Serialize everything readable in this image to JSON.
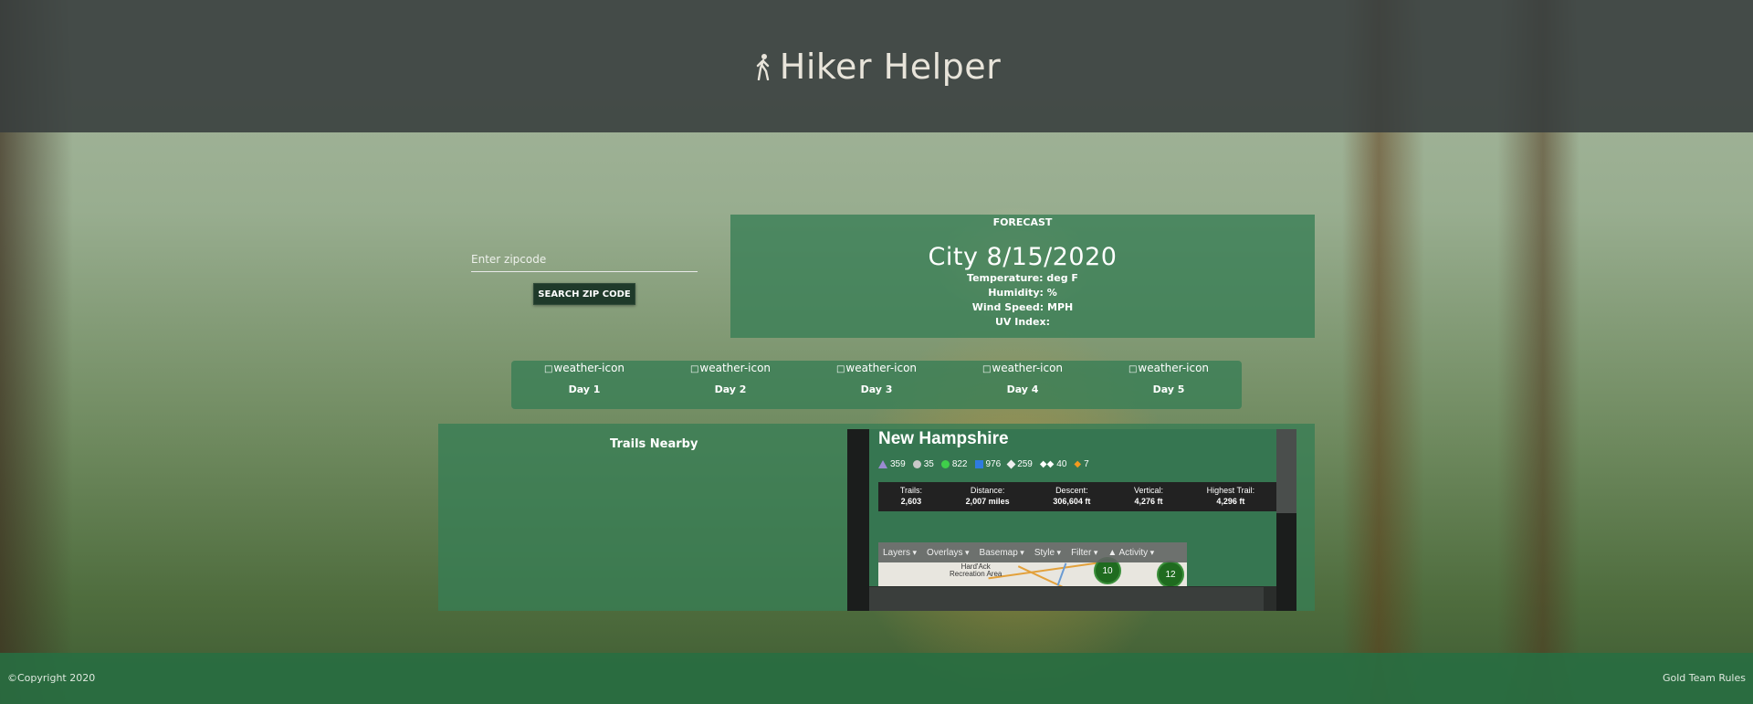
{
  "header": {
    "title": "Hiker Helper",
    "icon": "hiker-icon"
  },
  "search": {
    "placeholder": "Enter zipcode",
    "button_label": "SEARCH ZIP CODE"
  },
  "forecast": {
    "heading": "FORECAST",
    "city_date": "City 8/15/2020",
    "temperature": "Temperature: deg F",
    "humidity": "Humidity: %",
    "wind_speed": "Wind Speed: MPH",
    "uv_index": "UV Index:"
  },
  "days": [
    {
      "icon_alt": "weather-icon",
      "label": "Day 1"
    },
    {
      "icon_alt": "weather-icon",
      "label": "Day 2"
    },
    {
      "icon_alt": "weather-icon",
      "label": "Day 3"
    },
    {
      "icon_alt": "weather-icon",
      "label": "Day 4"
    },
    {
      "icon_alt": "weather-icon",
      "label": "Day 5"
    }
  ],
  "trails": {
    "heading": "Trails Nearby",
    "widget": {
      "state": "New Hampshire",
      "stats": [
        {
          "icon": "purple-triangle",
          "value": "359",
          "color": "#9b8bd2"
        },
        {
          "icon": "gray-circle",
          "value": "35",
          "color": "#c8c8c8"
        },
        {
          "icon": "green-circle",
          "value": "822",
          "color": "#3fcf4a"
        },
        {
          "icon": "blue-square",
          "value": "976",
          "color": "#2f7be0"
        },
        {
          "icon": "white-diamond",
          "value": "259",
          "color": "#eeeeee"
        },
        {
          "icon": "double-diamond",
          "value": "40",
          "color": "#eeeeee"
        },
        {
          "icon": "orange-hazard",
          "value": "7",
          "color": "#f39a1e"
        }
      ],
      "summary": [
        {
          "label": "Trails:",
          "value": "2,603"
        },
        {
          "label": "Distance:",
          "value": "2,007 miles"
        },
        {
          "label": "Descent:",
          "value": "306,604 ft"
        },
        {
          "label": "Vertical:",
          "value": "4,276 ft"
        },
        {
          "label": "Highest Trail:",
          "value": "4,296 ft"
        }
      ],
      "map_toolbar": [
        "Layers",
        "Overlays",
        "Basemap",
        "Style",
        "Filter",
        "Activity"
      ],
      "map_poi": "Hard'Ack\nRecreation Area",
      "clusters": [
        "10",
        "12"
      ]
    }
  },
  "footer": {
    "copyright": "©Copyright 2020",
    "team": "Gold Team Rules"
  }
}
